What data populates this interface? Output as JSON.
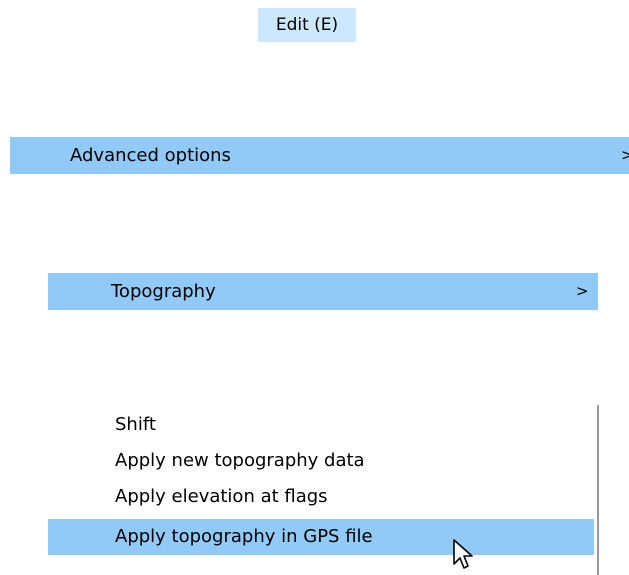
{
  "menubar": {
    "title": "Edit (E)"
  },
  "menu_level1": {
    "label": "Advanced options",
    "chevron": ">"
  },
  "menu_level2": {
    "label": "Topography",
    "chevron": ">"
  },
  "submenu": {
    "items": [
      {
        "label": "Shift"
      },
      {
        "label": "Apply new topography data"
      },
      {
        "label": "Apply elevation at flags"
      },
      {
        "label": "Apply topography in GPS file"
      }
    ]
  },
  "colors": {
    "highlight": "#91c9f7",
    "title_highlight": "#cce8ff",
    "submenu_border": "#9a9a9a"
  },
  "icons": {
    "cursor": "mouse-pointer-icon",
    "chevron": "chevron-right-icon"
  }
}
